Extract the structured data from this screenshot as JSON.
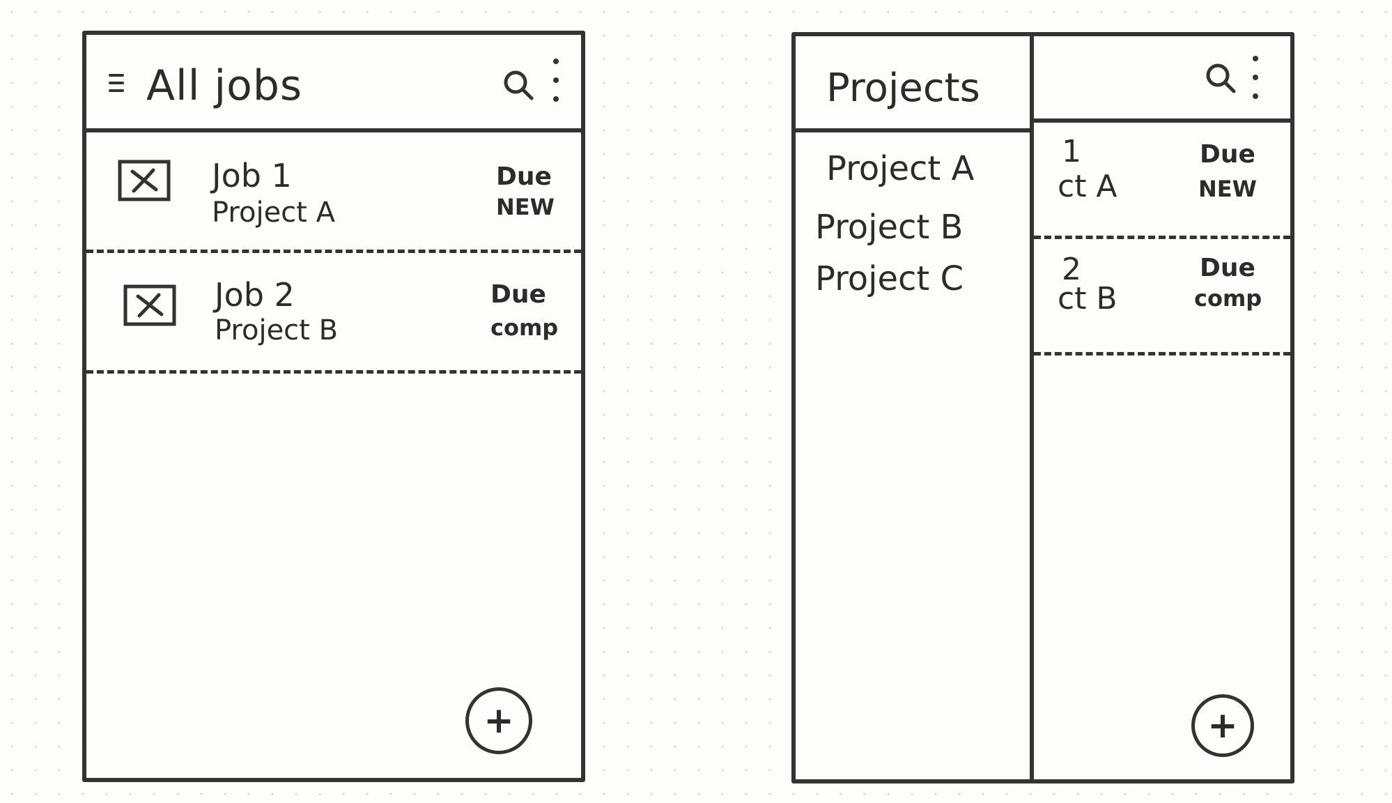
{
  "left_screen": {
    "app_bar": {
      "title": "All jobs",
      "search_icon": "search-icon",
      "more_icon": "more-vert-icon",
      "menu_icon": "menu-icon"
    },
    "jobs": [
      {
        "title": "Job 1",
        "project": "Project A",
        "due": "Due",
        "status": "NEW"
      },
      {
        "title": "Job 2",
        "project": "Project B",
        "due": "Due",
        "status": "comp"
      }
    ],
    "fab": {
      "label": "+"
    }
  },
  "right_screen": {
    "projects_pane": {
      "title": "Projects",
      "items": [
        "Project A",
        "Project B",
        "Project C"
      ]
    },
    "detail_pane": {
      "search_icon": "search-icon",
      "more_icon": "more-vert-icon",
      "jobs": [
        {
          "number": "1",
          "project": "ct A",
          "due": "Due",
          "status": "NEW"
        },
        {
          "number": "2",
          "project": "ct B",
          "due": "Due",
          "status": "comp"
        }
      ]
    },
    "fab": {
      "label": "+"
    }
  },
  "colors": {
    "ink": "#333333",
    "paper": "#fdfdfc",
    "grid_dot": "#d9d9d6"
  }
}
